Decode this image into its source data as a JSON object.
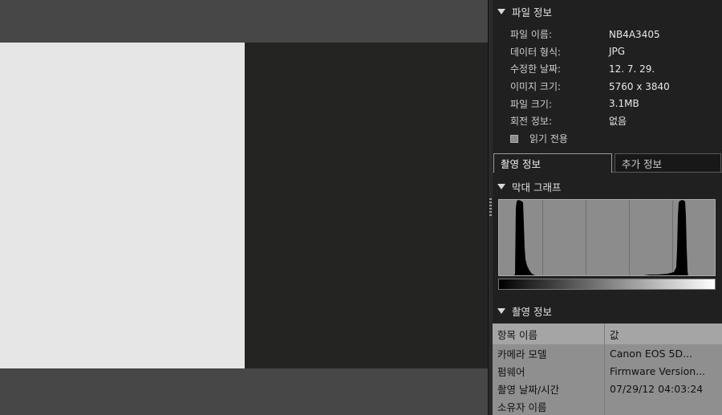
{
  "file_info": {
    "title": "파일 정보",
    "rows": [
      {
        "label": "파일 이름:",
        "value": "NB4A3405"
      },
      {
        "label": "데이터 형식:",
        "value": "JPG"
      },
      {
        "label": "수정한 날짜:",
        "value": "12. 7. 29."
      },
      {
        "label": "이미지 크기:",
        "value": "5760 x 3840"
      },
      {
        "label": "파일 크기:",
        "value": "3.1MB"
      },
      {
        "label": "회전 정보:",
        "value": "없음"
      }
    ],
    "readonly_label": "읽기 전용"
  },
  "tabs": {
    "active": "촬영 정보",
    "inactive": "추가 정보"
  },
  "histogram": {
    "title": "막대 그래프"
  },
  "shooting_info": {
    "title": "촬영 정보",
    "col_item": "항목 이름",
    "col_value": "값",
    "rows": [
      {
        "item": "카메라 모델",
        "value": "Canon EOS 5D..."
      },
      {
        "item": "펌웨어",
        "value": "Firmware Version..."
      },
      {
        "item": "촬영 날짜/시간",
        "value": "07/29/12 04:03:24"
      },
      {
        "item": "소유자 이름",
        "value": ""
      }
    ]
  },
  "colors": {
    "panel_bg": "#202020",
    "viewer_bg": "#474747",
    "table_bg": "#8f8f8f"
  }
}
